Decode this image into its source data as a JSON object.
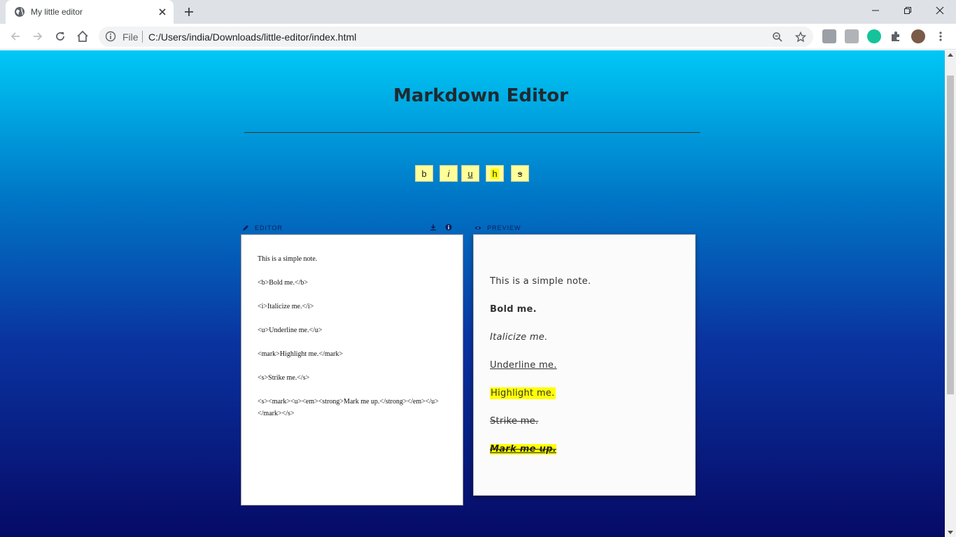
{
  "browser": {
    "tab_title": "My little editor",
    "omnibox_scheme_label": "File",
    "url": "C:/Users/india/Downloads/little-editor/index.html"
  },
  "app": {
    "title": "Markdown Editor",
    "format_buttons": [
      {
        "label": "b",
        "style": "bold"
      },
      {
        "label": "i",
        "style": "italic"
      },
      {
        "label": "u",
        "style": "underline"
      },
      {
        "label": "h",
        "style": "highlight"
      },
      {
        "label": "s",
        "style": "strikethrough"
      }
    ],
    "editor_label": "EDITOR",
    "preview_label": "PREVIEW",
    "editor_lines": [
      "This is a simple note.",
      "<b>Bold me.</b>",
      "<i>Italicize me.</i>",
      "<u>Underline me.</u>",
      "<mark>Highlight me.</mark>",
      "<s>Strike me.</s>",
      "<s><mark><u><em><strong>Mark me up.</strong></em></u></mark></s>"
    ],
    "preview_lines": {
      "plain": "This is a simple note.",
      "bold": "Bold me.",
      "italic": "Italicize me.",
      "underline": "Underline me.",
      "highlight": "Highlight me.",
      "strike": "Strike me.",
      "markup": "Mark me up."
    },
    "colors": {
      "button_bg": "#ffff99",
      "highlight": "#ffff00",
      "gradient_top": "#00c8f5",
      "gradient_bottom": "#060a66"
    }
  }
}
